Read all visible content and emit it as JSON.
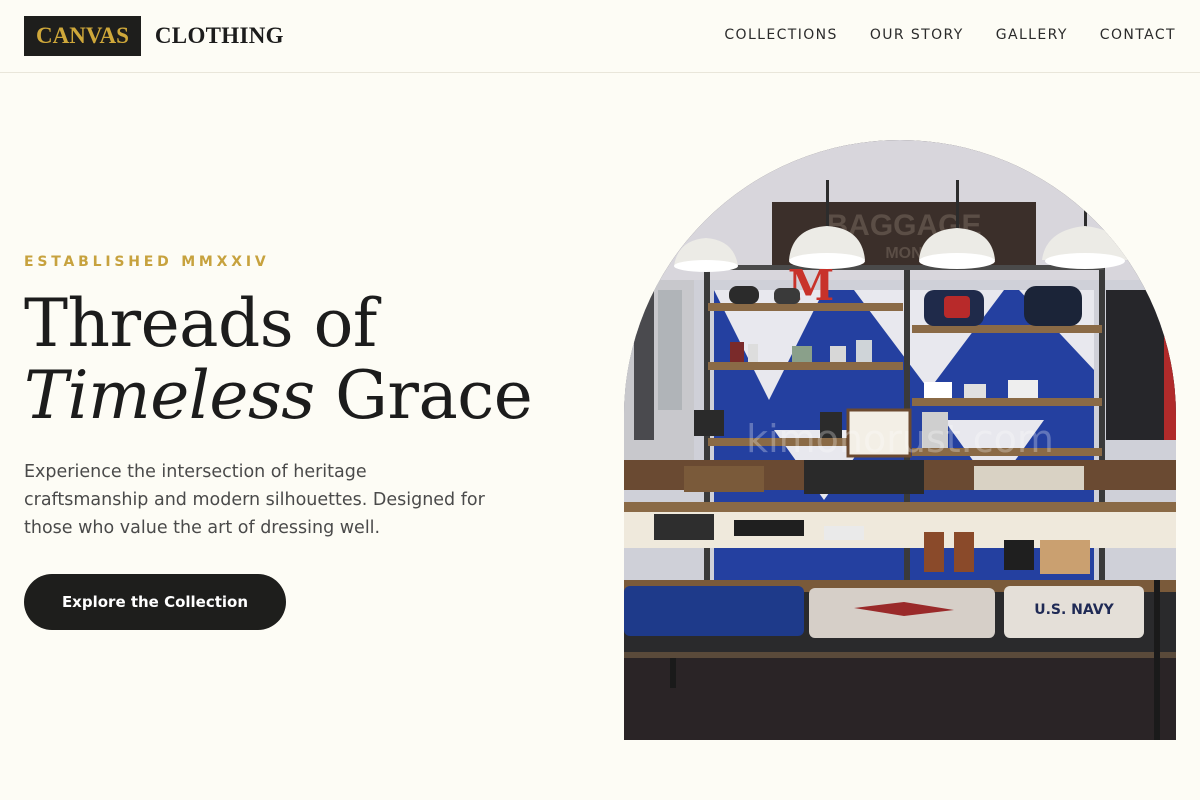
{
  "brand": {
    "boxed_word": "CANVAS",
    "word": "CLOTHING"
  },
  "nav": {
    "items": [
      {
        "label": "COLLECTIONS"
      },
      {
        "label": "OUR STORY"
      },
      {
        "label": "GALLERY"
      },
      {
        "label": "CONTACT"
      }
    ]
  },
  "hero": {
    "eyebrow": "ESTABLISHED MMXXIV",
    "headline_line1": "Threads of",
    "headline_italic": "Timeless",
    "headline_rest": "Grace",
    "description": "Experience the intersection of heritage craftsmanship and modern silhouettes. Designed for those who value the art of dressing well.",
    "cta_label": "Explore the Collection"
  },
  "image": {
    "banner_text": "BAGGAGE",
    "banner_sub": "MON",
    "shelf_letter": "M",
    "sweater_text": "U.S. NAVY",
    "watermark": "kimonorust.com"
  },
  "colors": {
    "background": "#fdfcf5",
    "accent_gold": "#c7a23e",
    "dark": "#1e1e1c",
    "wall_blue": "#2440a0"
  }
}
